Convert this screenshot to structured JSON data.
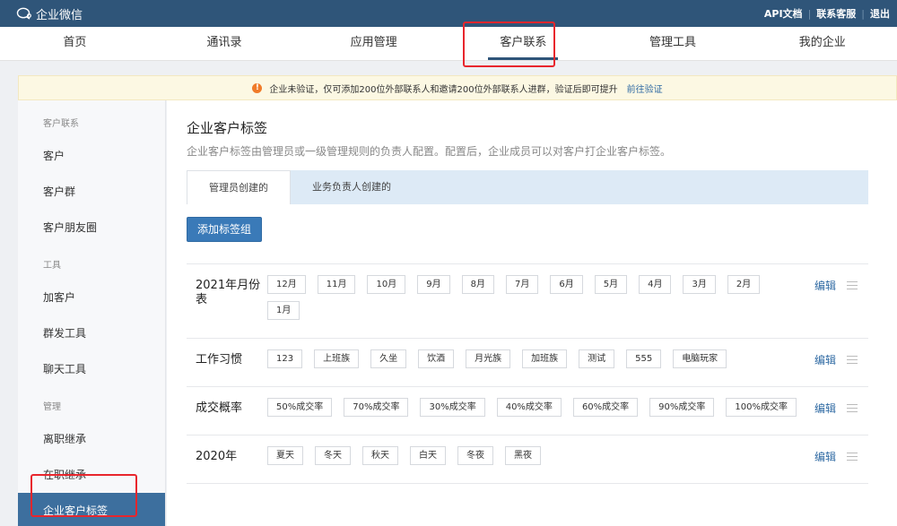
{
  "app": {
    "name": "企业微信"
  },
  "top_links": {
    "api_docs": "API文档",
    "support": "联系客服",
    "logout": "退出",
    "separator": "|"
  },
  "main_nav": [
    {
      "label": "首页",
      "active": false
    },
    {
      "label": "通讯录",
      "active": false
    },
    {
      "label": "应用管理",
      "active": false
    },
    {
      "label": "客户联系",
      "active": true
    },
    {
      "label": "管理工具",
      "active": false
    },
    {
      "label": "我的企业",
      "active": false
    }
  ],
  "notice": {
    "icon": "!",
    "text": "企业未验证，仅可添加200位外部联系人和邀请200位外部联系人进群，验证后即可提升",
    "link": "前往验证"
  },
  "sidebar": {
    "group1": "客户联系",
    "item_customer": "客户",
    "item_customer_group": "客户群",
    "item_moments": "客户朋友圈",
    "group2": "工具",
    "item_add_customer": "加客户",
    "item_mass_send": "群发工具",
    "item_chat_tools": "聊天工具",
    "group3": "管理",
    "item_resign_inherit": "离职继承",
    "item_onjob_inherit": "在职继承",
    "item_tags": "企业客户标签"
  },
  "page": {
    "title": "企业客户标签",
    "desc": "企业客户标签由管理员或一级管理规则的负责人配置。配置后，企业成员可以对客户打企业客户标签。",
    "tab_admin": "管理员创建的",
    "tab_owner": "业务负责人创建的",
    "add_button": "添加标签组",
    "edit_label": "编辑"
  },
  "tag_groups": [
    {
      "name": "2021年月份表",
      "tags": [
        "12月",
        "11月",
        "10月",
        "9月",
        "8月",
        "7月",
        "6月",
        "5月",
        "4月",
        "3月",
        "2月",
        "1月"
      ]
    },
    {
      "name": "工作习惯",
      "tags": [
        "123",
        "上班族",
        "久坐",
        "饮酒",
        "月光族",
        "加班族",
        "测试",
        "555",
        "电脑玩家"
      ]
    },
    {
      "name": "成交概率",
      "tags": [
        "50%成交率",
        "70%成交率",
        "30%成交率",
        "40%成交率",
        "60%成交率",
        "90%成交率",
        "100%成交率"
      ]
    },
    {
      "name": "2020年",
      "tags": [
        "夏天",
        "冬天",
        "秋天",
        "白天",
        "冬夜",
        "黑夜"
      ]
    }
  ],
  "colors": {
    "topbar": "#2f5579",
    "accent": "#3a7ab8",
    "highlight": "#e8262d",
    "notice_bg": "#fcf8e3"
  }
}
